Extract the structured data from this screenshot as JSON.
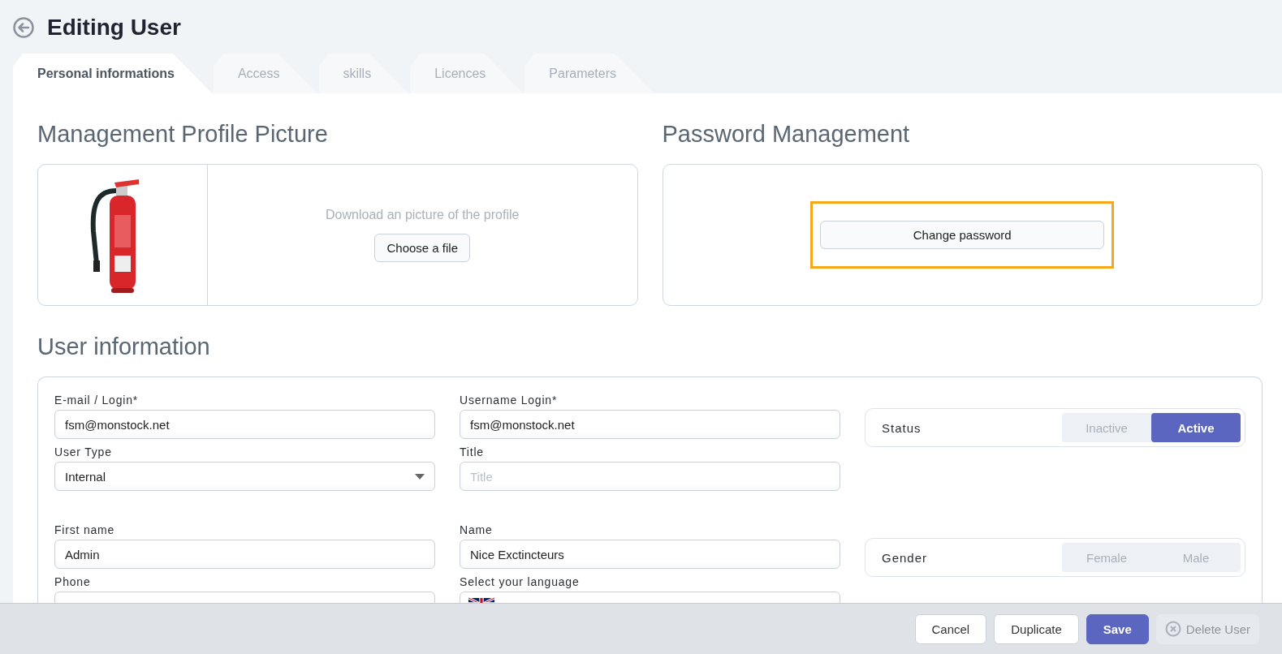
{
  "header": {
    "title": "Editing User"
  },
  "tabs": [
    {
      "label": "Personal informations",
      "selected": true
    },
    {
      "label": "Access",
      "selected": false
    },
    {
      "label": "skills",
      "selected": false
    },
    {
      "label": "Licences",
      "selected": false
    },
    {
      "label": "Parameters",
      "selected": false
    }
  ],
  "profile_picture": {
    "heading": "Management Profile Picture",
    "hint": "Download an picture of the profile",
    "button": "Choose a file"
  },
  "password": {
    "heading": "Password Management",
    "button": "Change password",
    "highlighted": true
  },
  "user_information": {
    "heading": "User information",
    "groups": [
      {
        "fields": [
          {
            "label": "E-mail / Login*",
            "value": "fsm@monstock.net",
            "kind": "text"
          },
          {
            "label": "Username Login*",
            "value": "fsm@monstock.net",
            "kind": "text"
          },
          {
            "label": "User Type",
            "value": "Internal",
            "kind": "select"
          },
          {
            "label": "Title",
            "placeholder": "Title",
            "kind": "text"
          }
        ],
        "toggle": {
          "label": "Status",
          "options": [
            {
              "label": "Inactive",
              "selected": false
            },
            {
              "label": "Active",
              "selected": true
            }
          ]
        }
      },
      {
        "fields": [
          {
            "label": "First name",
            "value": "Admin",
            "kind": "text"
          },
          {
            "label": "Name",
            "value": "Nice Exctincteurs",
            "kind": "text"
          },
          {
            "label": "Phone",
            "kind": "text"
          },
          {
            "label": "Select your language",
            "kind": "language"
          }
        ],
        "toggle": {
          "label": "Gender",
          "options": [
            {
              "label": "Female",
              "selected": false
            },
            {
              "label": "Male",
              "selected": false
            }
          ]
        }
      }
    ]
  },
  "footer": {
    "buttons": [
      {
        "label": "Cancel",
        "kind": "default"
      },
      {
        "label": "Duplicate",
        "kind": "default"
      },
      {
        "label": "Save",
        "kind": "primary"
      },
      {
        "label": "Delete User",
        "kind": "disabled"
      }
    ]
  }
}
